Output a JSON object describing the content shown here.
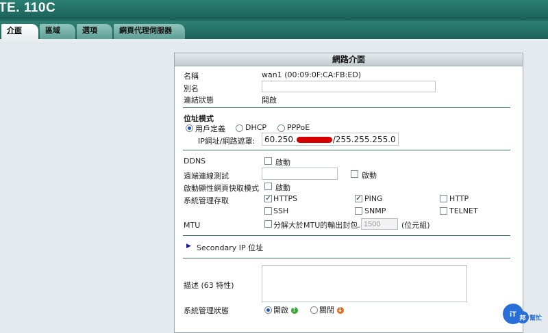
{
  "brand": "TE. 110C",
  "tabs": [
    "介面",
    "區域",
    "選項",
    "網頁代理伺服器"
  ],
  "panel": {
    "title": "網路介面"
  },
  "info": {
    "name_label": "名稱",
    "name_value": "wan1 (00:09:0F:CA:FB:ED)",
    "alias_label": "別名",
    "alias_value": "",
    "link_label": "連結狀態",
    "link_value": "開啟"
  },
  "addr": {
    "section_label": "位址模式",
    "modes": [
      "用戶定義",
      "DHCP",
      "PPPoE"
    ],
    "selected_mode": "用戶定義",
    "ip_label": "IP網址/網路遮罩:",
    "ip_prefix": "60.250.",
    "ip_suffix": "/255.255.255.0"
  },
  "opts": {
    "ddns_label": "DDNS",
    "remote_test_label": "遠端連線測試",
    "remote_test_value": "",
    "reverse_proxy_label": "啟動顯性網頁快取模式",
    "mgmt_access_label": "系統管理存取",
    "mtu_label": "MTU",
    "enable_label": "啟動"
  },
  "access": [
    {
      "name": "HTTPS",
      "checked": true
    },
    {
      "name": "PING",
      "checked": true
    },
    {
      "name": "HTTP",
      "checked": false
    },
    {
      "name": "SSH",
      "checked": false
    },
    {
      "name": "SNMP",
      "checked": false
    },
    {
      "name": "TELNET",
      "checked": false
    }
  ],
  "mtu": {
    "checkbox_label": "分解大於MTU的輸出封包.",
    "value": "1500",
    "unit": "(位元組)"
  },
  "secondary": {
    "label": "Secondary IP 位址"
  },
  "desc": {
    "label": "描述 (63 特性)",
    "value": ""
  },
  "admin_status": {
    "label": "系統管理狀態",
    "options": [
      "開啟",
      "關閉"
    ],
    "selected": "開啟"
  },
  "watermark": {
    "text": "iT邦幫忙",
    "color": "#2a6fd8"
  }
}
